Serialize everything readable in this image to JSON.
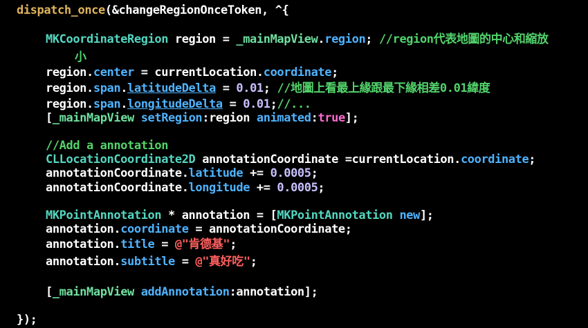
{
  "editor": {
    "lines": [
      [
        {
          "text": "dispatch_once",
          "role": "function"
        },
        {
          "text": "(&changeRegionOnceToken, ^{",
          "role": "plain"
        }
      ],
      [
        {
          "text": "MKCoordinateRegion",
          "role": "type"
        },
        {
          "text": " region = ",
          "role": "plain"
        },
        {
          "text": "_mainMapView",
          "role": "ivar"
        },
        {
          "text": ".",
          "role": "plain"
        },
        {
          "text": "region",
          "role": "property"
        },
        {
          "text": "; ",
          "role": "plain"
        },
        {
          "text": "//region代表地圖的中心和縮放",
          "role": "comment"
        }
      ],
      [
        {
          "text": "小",
          "role": "comment"
        }
      ],
      [
        {
          "text": "region.",
          "role": "plain"
        },
        {
          "text": "center",
          "role": "property"
        },
        {
          "text": " = currentLocation.",
          "role": "plain"
        },
        {
          "text": "coordinate",
          "role": "property"
        },
        {
          "text": ";",
          "role": "plain"
        }
      ],
      [
        {
          "text": "region.",
          "role": "plain"
        },
        {
          "text": "span",
          "role": "property"
        },
        {
          "text": ".",
          "role": "plain"
        },
        {
          "text": "latitudeDelta",
          "role": "property-link"
        },
        {
          "text": " = ",
          "role": "plain"
        },
        {
          "text": "0.01",
          "role": "number"
        },
        {
          "text": "; ",
          "role": "plain"
        },
        {
          "text": "//地圖上看最上緣跟最下緣相差0.01緯度",
          "role": "comment"
        }
      ],
      [
        {
          "text": "region.",
          "role": "plain"
        },
        {
          "text": "span",
          "role": "property"
        },
        {
          "text": ".",
          "role": "plain"
        },
        {
          "text": "longitudeDelta",
          "role": "property-link"
        },
        {
          "text": " = ",
          "role": "plain"
        },
        {
          "text": "0.01",
          "role": "number"
        },
        {
          "text": ";",
          "role": "plain"
        },
        {
          "text": "//...",
          "role": "comment"
        }
      ],
      [
        {
          "text": "[",
          "role": "plain"
        },
        {
          "text": "_mainMapView",
          "role": "ivar"
        },
        {
          "text": " ",
          "role": "plain"
        },
        {
          "text": "setRegion",
          "role": "property"
        },
        {
          "text": ":region ",
          "role": "plain"
        },
        {
          "text": "animated",
          "role": "property"
        },
        {
          "text": ":",
          "role": "plain"
        },
        {
          "text": "true",
          "role": "keyword"
        },
        {
          "text": "];",
          "role": "plain"
        }
      ],
      [
        {
          "text": "//Add a annotation",
          "role": "comment"
        }
      ],
      [
        {
          "text": "CLLocationCoordinate2D",
          "role": "type"
        },
        {
          "text": " annotationCoordinate =currentLocation.",
          "role": "plain"
        },
        {
          "text": "coordinate",
          "role": "property"
        },
        {
          "text": ";",
          "role": "plain"
        }
      ],
      [
        {
          "text": "annotationCoordinate.",
          "role": "plain"
        },
        {
          "text": "latitude",
          "role": "property"
        },
        {
          "text": " += ",
          "role": "plain"
        },
        {
          "text": "0.0005",
          "role": "number"
        },
        {
          "text": ";",
          "role": "plain"
        }
      ],
      [
        {
          "text": "annotationCoordinate.",
          "role": "plain"
        },
        {
          "text": "longitude",
          "role": "property"
        },
        {
          "text": " += ",
          "role": "plain"
        },
        {
          "text": "0.0005",
          "role": "number"
        },
        {
          "text": ";",
          "role": "plain"
        }
      ],
      [
        {
          "text": "MKPointAnnotation",
          "role": "type"
        },
        {
          "text": " * annotation = [",
          "role": "plain"
        },
        {
          "text": "MKPointAnnotation",
          "role": "type"
        },
        {
          "text": " ",
          "role": "plain"
        },
        {
          "text": "new",
          "role": "property"
        },
        {
          "text": "];",
          "role": "plain"
        }
      ],
      [
        {
          "text": "annotation.",
          "role": "plain"
        },
        {
          "text": "coordinate",
          "role": "property"
        },
        {
          "text": " = annotationCoordinate;",
          "role": "plain"
        }
      ],
      [
        {
          "text": "annotation.",
          "role": "plain"
        },
        {
          "text": "title",
          "role": "property"
        },
        {
          "text": " = ",
          "role": "plain"
        },
        {
          "text": "@\"肯德基\"",
          "role": "string"
        },
        {
          "text": ";",
          "role": "plain"
        }
      ],
      [
        {
          "text": "annotation.",
          "role": "plain"
        },
        {
          "text": "subtitle",
          "role": "property"
        },
        {
          "text": " = ",
          "role": "plain"
        },
        {
          "text": "@\"真好吃\"",
          "role": "string"
        },
        {
          "text": ";",
          "role": "plain"
        }
      ],
      [
        {
          "text": "[",
          "role": "plain"
        },
        {
          "text": "_mainMapView",
          "role": "ivar"
        },
        {
          "text": " ",
          "role": "plain"
        },
        {
          "text": "addAnnotation",
          "role": "property"
        },
        {
          "text": ":annotation];",
          "role": "plain"
        }
      ],
      [
        {
          "text": "});",
          "role": "plain"
        }
      ]
    ]
  },
  "theme": {
    "background": "#000000",
    "plain": "#ffffff",
    "function": "#e0b45a",
    "type": "#54d6c0",
    "ivar": "#6fe0a0",
    "property": "#4fb3ff",
    "comment": "#52d36b",
    "number": "#c7c0ff",
    "keyword": "#ff6bd0",
    "string": "#ff5f5f"
  }
}
